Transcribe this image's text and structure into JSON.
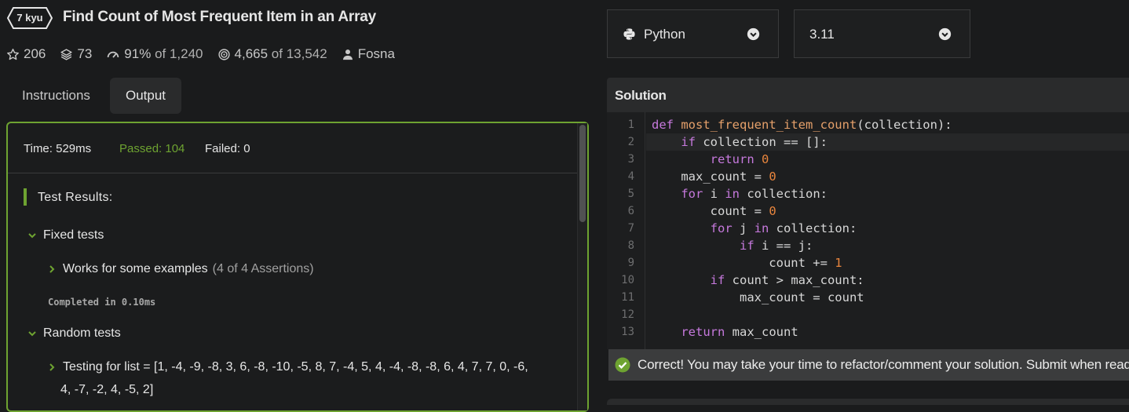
{
  "kata": {
    "rank": "7 kyu",
    "title": "Find Count of Most Frequent Item in an Array"
  },
  "stats": {
    "stars": "206",
    "collections": "73",
    "satisfaction": "91%",
    "satisfaction_of": "of 1,240",
    "completions": "4,665",
    "completions_of": "of 13,542",
    "author": "Fosna",
    "icons": [
      "star-icon",
      "stack-icon",
      "gauge-icon",
      "target-icon",
      "user-icon"
    ]
  },
  "tabs": [
    {
      "label": "Instructions",
      "active": false
    },
    {
      "label": "Output",
      "active": true
    }
  ],
  "output": {
    "time": "Time: 529ms",
    "passed": "Passed: 104",
    "failed": "Failed: 0",
    "results_title": "Test Results:",
    "fixed_group": "Fixed tests",
    "fixed_item": "Works for some examples",
    "fixed_assertions": "(4 of 4 Assertions)",
    "completed": "Completed in 0.10ms",
    "random_group": "Random tests",
    "random_item_line1": "Testing for list = [1, -4, -9, -8, 3, 6, -8, -10, -5, 8, 7, -4, 5, 4, -4, -8, -8, 6, 4, 7, 7, 0, -6,",
    "random_item_line2": "4, -7, -2, 4, -5, 2]"
  },
  "language_select": {
    "value": "Python"
  },
  "version_select": {
    "value": "3.11"
  },
  "solution": {
    "header": "Solution",
    "line_numbers": [
      "1",
      "2",
      "3",
      "4",
      "5",
      "6",
      "7",
      "8",
      "9",
      "10",
      "11",
      "12",
      "13"
    ],
    "code_lines": [
      "def most_frequent_item_count(collection):",
      "    if collection == []:",
      "        return 0",
      "    max_count = 0",
      "    for i in collection:",
      "        count = 0",
      "        for j in collection:",
      "            if i == j:",
      "                count += 1",
      "        if count > max_count:",
      "            max_count = count",
      "",
      "    return max_count"
    ]
  },
  "status_message": "Correct! You may take your time to refactor/comment your solution. Submit when ready.",
  "colors": {
    "accent_green": "#6ea331",
    "background": "#1a1b1c",
    "keyword": "#c679dd",
    "function": "#e5a06a",
    "number": "#e8853d"
  }
}
